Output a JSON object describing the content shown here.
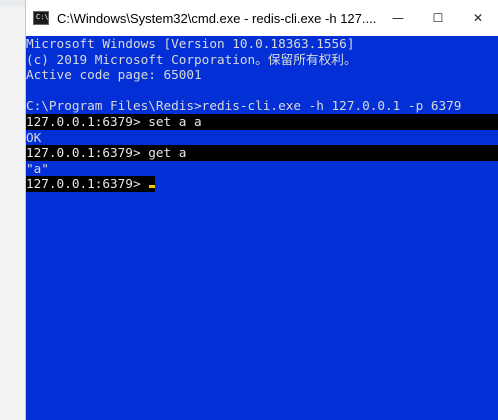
{
  "window": {
    "title": "C:\\Windows\\System32\\cmd.exe - redis-cli.exe  -h 127....",
    "icon": "cmd-icon",
    "icon_text": "C:\\",
    "controls": {
      "minimize": "—",
      "maximize": "☐",
      "close": "✕"
    }
  },
  "colors": {
    "console_bg": "#0330d6",
    "text": "#d9d9d9",
    "highlight_bg": "#000000",
    "cursor": "#f5c400"
  },
  "console": {
    "lines": [
      {
        "text": "Microsoft Windows [Version 10.0.18363.1556]",
        "highlight": false
      },
      {
        "text": "(c) 2019 Microsoft Corporation。保留所有权利。",
        "highlight": false
      },
      {
        "text": "Active code page: 65001",
        "highlight": false
      },
      {
        "text": "",
        "highlight": false
      },
      {
        "text": "C:\\Program Files\\Redis>redis-cli.exe -h 127.0.0.1 -p 6379",
        "highlight": false
      },
      {
        "text": "127.0.0.1:6379> set a a",
        "highlight": true
      },
      {
        "text": "OK",
        "highlight": false
      },
      {
        "text": "127.0.0.1:6379> get a",
        "highlight": true
      },
      {
        "text": "\"a\"",
        "highlight": false
      },
      {
        "text": "127.0.0.1:6379> ",
        "highlight": true,
        "cursor": true
      }
    ]
  }
}
